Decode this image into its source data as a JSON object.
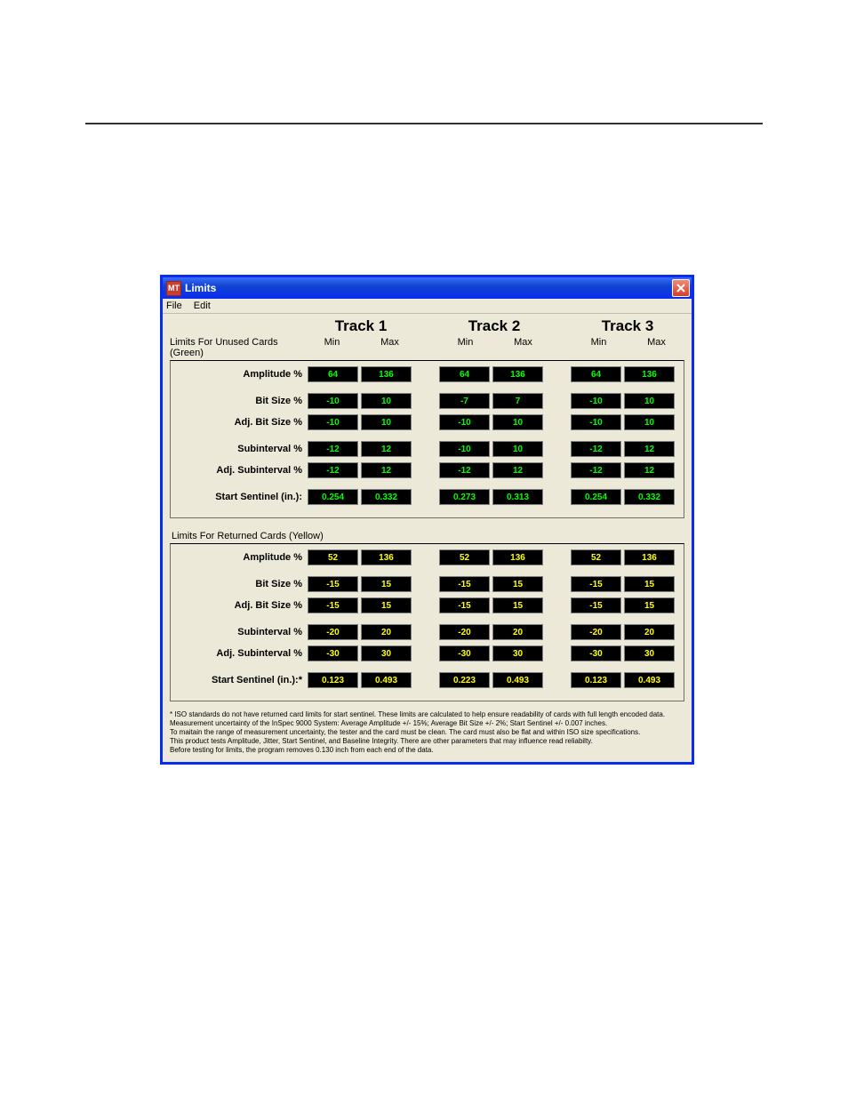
{
  "title": {
    "icon": "MT",
    "text": "Limits"
  },
  "menu": {
    "file": "File",
    "edit": "Edit"
  },
  "headers": {
    "track1": "Track 1",
    "track2": "Track 2",
    "track3": "Track 3",
    "min": "Min",
    "max": "Max"
  },
  "sections": {
    "unused": "Limits For Unused Cards (Green)",
    "returned": "Limits For Returned Cards (Yellow)"
  },
  "row_labels": {
    "amp": "Amplitude %",
    "bit": "Bit Size %",
    "abit": "Adj. Bit Size %",
    "sub": "Subinterval %",
    "asub": "Adj. Subinterval %",
    "ss": "Start Sentinel (in.):",
    "ssy": "Start Sentinel (in.):*"
  },
  "green": {
    "amp": {
      "t1": {
        "min": "64",
        "max": "136"
      },
      "t2": {
        "min": "64",
        "max": "136"
      },
      "t3": {
        "min": "64",
        "max": "136"
      }
    },
    "bit": {
      "t1": {
        "min": "-10",
        "max": "10"
      },
      "t2": {
        "min": "-7",
        "max": "7"
      },
      "t3": {
        "min": "-10",
        "max": "10"
      }
    },
    "abit": {
      "t1": {
        "min": "-10",
        "max": "10"
      },
      "t2": {
        "min": "-10",
        "max": "10"
      },
      "t3": {
        "min": "-10",
        "max": "10"
      }
    },
    "sub": {
      "t1": {
        "min": "-12",
        "max": "12"
      },
      "t2": {
        "min": "-10",
        "max": "10"
      },
      "t3": {
        "min": "-12",
        "max": "12"
      }
    },
    "asub": {
      "t1": {
        "min": "-12",
        "max": "12"
      },
      "t2": {
        "min": "-12",
        "max": "12"
      },
      "t3": {
        "min": "-12",
        "max": "12"
      }
    },
    "ss": {
      "t1": {
        "min": "0.254",
        "max": "0.332"
      },
      "t2": {
        "min": "0.273",
        "max": "0.313"
      },
      "t3": {
        "min": "0.254",
        "max": "0.332"
      }
    }
  },
  "yellow": {
    "amp": {
      "t1": {
        "min": "52",
        "max": "136"
      },
      "t2": {
        "min": "52",
        "max": "136"
      },
      "t3": {
        "min": "52",
        "max": "136"
      }
    },
    "bit": {
      "t1": {
        "min": "-15",
        "max": "15"
      },
      "t2": {
        "min": "-15",
        "max": "15"
      },
      "t3": {
        "min": "-15",
        "max": "15"
      }
    },
    "abit": {
      "t1": {
        "min": "-15",
        "max": "15"
      },
      "t2": {
        "min": "-15",
        "max": "15"
      },
      "t3": {
        "min": "-15",
        "max": "15"
      }
    },
    "sub": {
      "t1": {
        "min": "-20",
        "max": "20"
      },
      "t2": {
        "min": "-20",
        "max": "20"
      },
      "t3": {
        "min": "-20",
        "max": "20"
      }
    },
    "asub": {
      "t1": {
        "min": "-30",
        "max": "30"
      },
      "t2": {
        "min": "-30",
        "max": "30"
      },
      "t3": {
        "min": "-30",
        "max": "30"
      }
    },
    "ss": {
      "t1": {
        "min": "0.123",
        "max": "0.493"
      },
      "t2": {
        "min": "0.223",
        "max": "0.493"
      },
      "t3": {
        "min": "0.123",
        "max": "0.493"
      }
    }
  },
  "row_order": [
    "amp",
    "bit",
    "abit",
    "sub",
    "asub",
    "ss"
  ],
  "gaps_after": {
    "amp": true,
    "abit": true,
    "asub": true
  },
  "footnote": "* ISO standards do not have returned card limits for start sentinel. These limits are calculated to help ensure readability of cards with full length encoded data.\nMeasurement uncertainty of the InSpec 9000 System: Average Amplitude +/- 15%;  Average Bit Size +/- 2%;  Start Sentinel +/- 0.007 inches.\nTo maitain the range of measurement uncertainty, the tester and the card must be clean. The card must also be flat and within ISO size specifications.\nThis product tests Amplitude, Jitter, Start Sentinel, and Baseline Integrity. There are other parameters that may influence read reliabilty.\nBefore testing for limits, the program removes 0.130 inch from each end of the data."
}
